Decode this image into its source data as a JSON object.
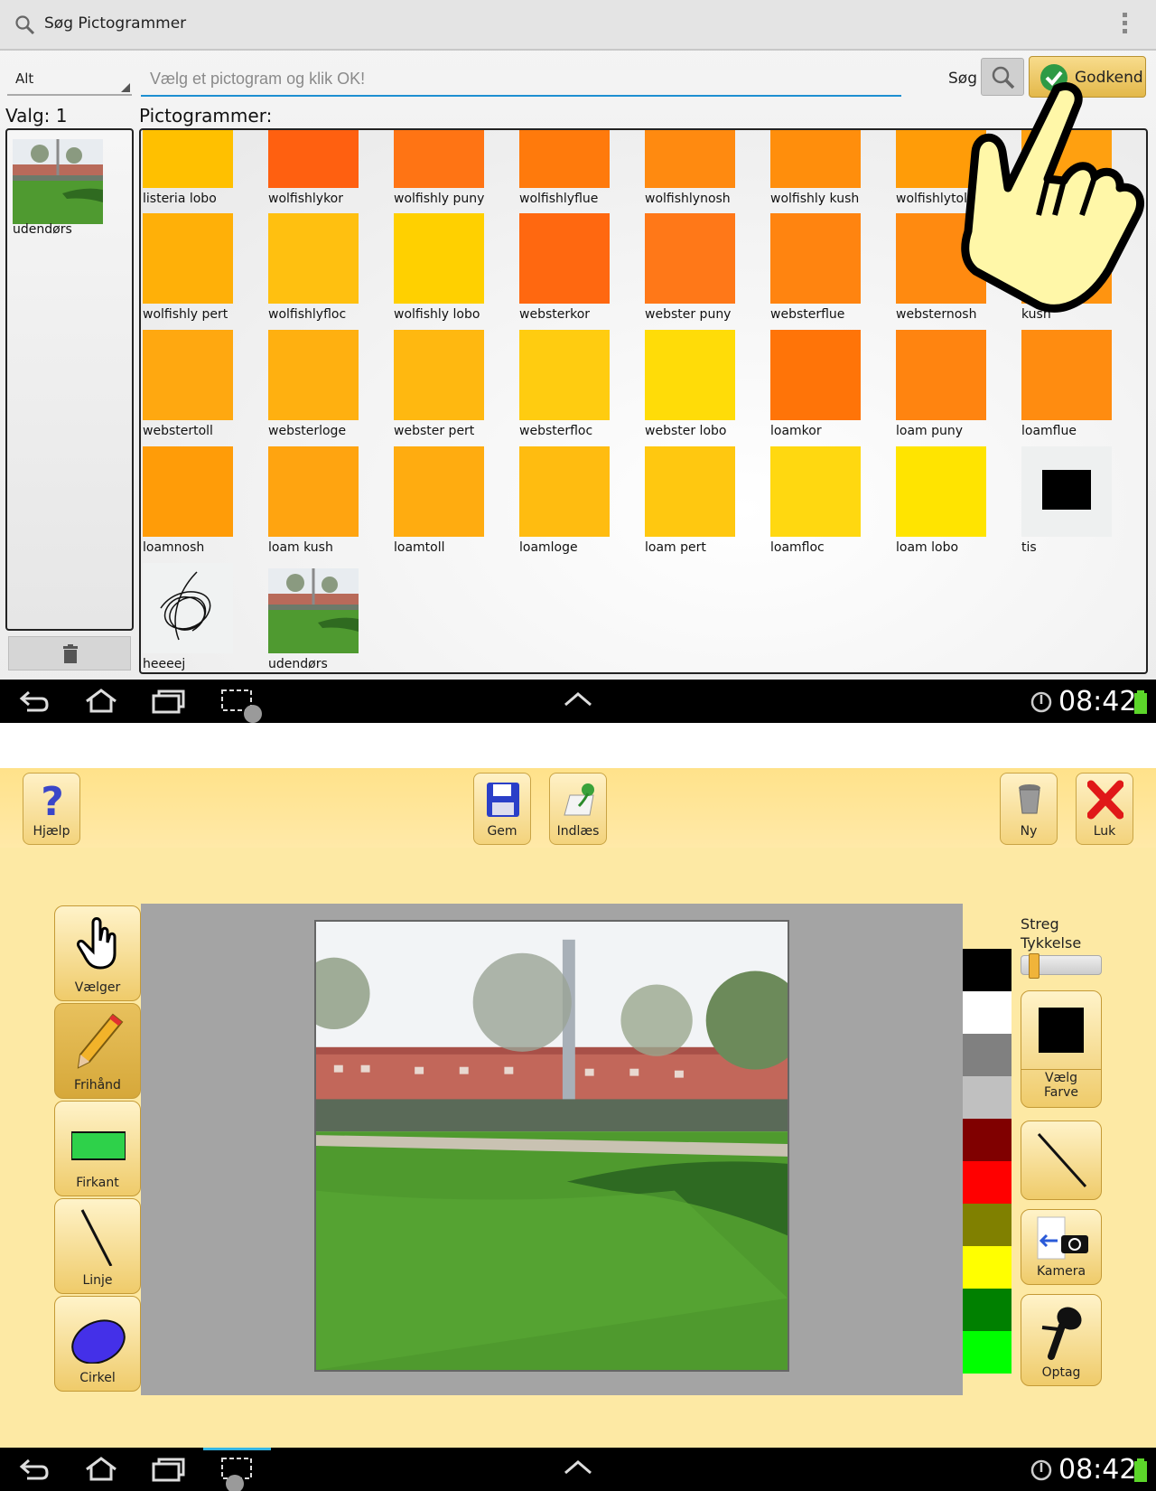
{
  "top_screen": {
    "header": {
      "title": "Søg Pictogrammer"
    },
    "filter": {
      "value": "Alt"
    },
    "search": {
      "placeholder": "Vælg et pictogram og klik OK!",
      "button_label": "Søg"
    },
    "confirm_button": {
      "label": "Godkend"
    },
    "selected_panel": {
      "label": "Valg: 1",
      "item_label": "udendørs"
    },
    "pictograms": {
      "label": "Pictogrammer:",
      "items": [
        {
          "name": "listeria lobo",
          "color": "#ffc000"
        },
        {
          "name": "wolfishlykor",
          "color": "#ff6010"
        },
        {
          "name": "wolfishly puny",
          "color": "#ff7414"
        },
        {
          "name": "wolfishlyflue",
          "color": "#ff7a0c"
        },
        {
          "name": "wolfishlynosh",
          "color": "#ff8a10"
        },
        {
          "name": "wolfishly kush",
          "color": "#ff8e0c"
        },
        {
          "name": "wolfishlytoll",
          "color": "#ff9c08"
        },
        {
          "name": "",
          "color": "#ffa010"
        },
        {
          "name": "wolfishly pert",
          "color": "#ffb008"
        },
        {
          "name": "wolfishlyfloc",
          "color": "#ffc010"
        },
        {
          "name": "wolfishly lobo",
          "color": "#ffd000"
        },
        {
          "name": "websterkor",
          "color": "#ff6810"
        },
        {
          "name": "webster puny",
          "color": "#ff7818"
        },
        {
          "name": "websterflue",
          "color": "#ff8410"
        },
        {
          "name": "websternosh",
          "color": "#ff8a10"
        },
        {
          "name": "kush",
          "color": "#ff9410"
        },
        {
          "name": "webstertoll",
          "color": "#ffa810"
        },
        {
          "name": "websterloge",
          "color": "#ffb010"
        },
        {
          "name": "webster pert",
          "color": "#ffb810"
        },
        {
          "name": "websterfloc",
          "color": "#ffcc10"
        },
        {
          "name": "webster lobo",
          "color": "#ffdc08"
        },
        {
          "name": "loamkor",
          "color": "#ff7408"
        },
        {
          "name": "loam puny",
          "color": "#ff8410"
        },
        {
          "name": "loamflue",
          "color": "#ff8c10"
        },
        {
          "name": "loamnosh",
          "color": "#ff9c08"
        },
        {
          "name": "loam kush",
          "color": "#ffa410"
        },
        {
          "name": "loamtoll",
          "color": "#ffac10"
        },
        {
          "name": "loamloge",
          "color": "#ffbc10"
        },
        {
          "name": "loam pert",
          "color": "#ffc810"
        },
        {
          "name": "loamfloc",
          "color": "#ffd810"
        },
        {
          "name": "loam lobo",
          "color": "#ffe400"
        },
        {
          "name": "tis",
          "color": "#000000",
          "kind": "black-square"
        },
        {
          "name": "heeeej",
          "color": "#000000",
          "kind": "scribble"
        },
        {
          "name": "udendørs",
          "color": "#5a9c3a",
          "kind": "photo"
        }
      ]
    },
    "status": {
      "time": "08:42"
    }
  },
  "bottom_screen": {
    "toolbar": {
      "help": "Hjælp",
      "save": "Gem",
      "load": "Indlæs",
      "new": "Ny",
      "close": "Luk"
    },
    "tools": {
      "select": "Vælger",
      "freehand": "Frihånd",
      "rectangle": "Firkant",
      "line": "Linje",
      "circle": "Cirkel"
    },
    "stroke": {
      "label_line1": "Streg",
      "label_line2": "Tykkelse",
      "level": 0.1
    },
    "color_button": {
      "line1": "Vælg",
      "line2": "Farve"
    },
    "camera": "Kamera",
    "record": "Optag",
    "palette": [
      "#000000",
      "#ffffff",
      "#808080",
      "#c0c0c0",
      "#800000",
      "#ff0000",
      "#808000",
      "#ffff00",
      "#008000",
      "#00ff00"
    ],
    "status": {
      "time": "08:42"
    }
  }
}
